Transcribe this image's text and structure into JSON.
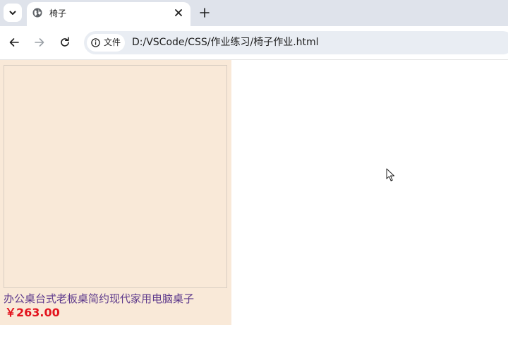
{
  "tab": {
    "title": "椅子"
  },
  "address_bar": {
    "chip_label": "文件",
    "url": "D:/VSCode/CSS/作业练习/椅子作业.html"
  },
  "product": {
    "title": "办公桌台式老板桌简约现代家用电脑桌子",
    "price": "￥263.00"
  },
  "icons": {
    "tab_search": "chevron-down-icon",
    "favicon": "globe-icon",
    "tab_close": "close-icon",
    "new_tab": "plus-icon",
    "back": "back-arrow-icon",
    "forward": "forward-arrow-icon",
    "reload": "reload-icon",
    "site_info": "info-icon",
    "cursor": "mouse-pointer-icon"
  },
  "colors": {
    "card_background": "#f9e9d8",
    "title_color": "#5e3a8c",
    "price_color": "#e3141e"
  }
}
